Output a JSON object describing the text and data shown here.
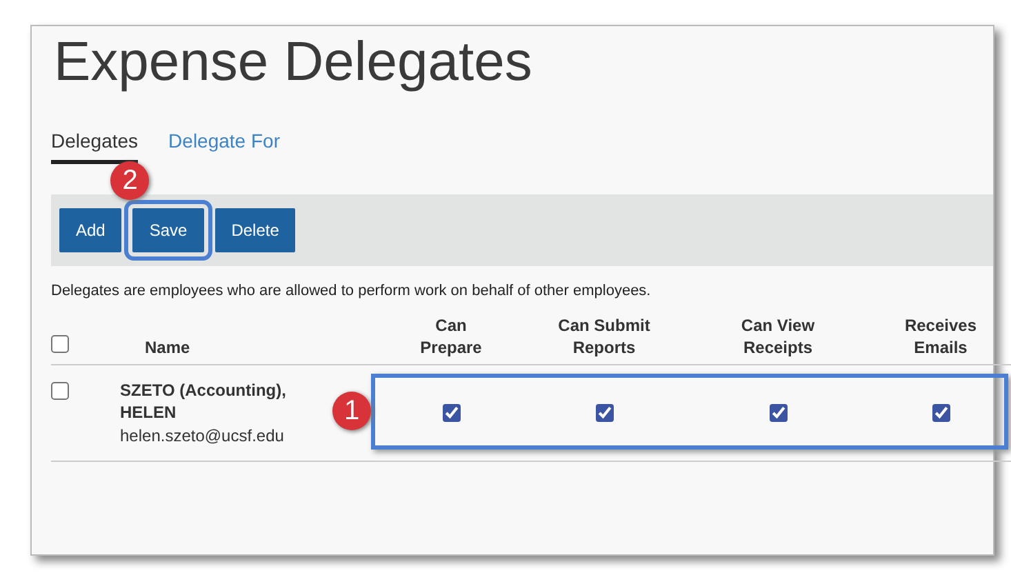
{
  "title": "Expense Delegates",
  "tabs": [
    {
      "label": "Delegates",
      "selected": true
    },
    {
      "label": "Delegate For",
      "selected": false
    }
  ],
  "buttons": [
    {
      "label": "Add",
      "highlighted": false
    },
    {
      "label": "Save",
      "highlighted": true,
      "callout": "2"
    },
    {
      "label": "Delete",
      "highlighted": false
    }
  ],
  "description": "Delegates are employees who are allowed to perform work on behalf of other employees.",
  "table": {
    "select_all_checked": false,
    "columns": [
      "Name",
      "Can Prepare",
      "Can Submit Reports",
      "Can View Receipts",
      "Receives Emails"
    ],
    "rows": [
      {
        "checked": false,
        "name": "SZETO (Accounting), HELEN",
        "email": "helen.szeto@ucsf.edu",
        "permissions_highlighted": true,
        "callout": "1",
        "permissions": [
          {
            "checked": true
          },
          {
            "checked": true
          },
          {
            "checked": true
          },
          {
            "checked": true
          }
        ]
      }
    ]
  }
}
